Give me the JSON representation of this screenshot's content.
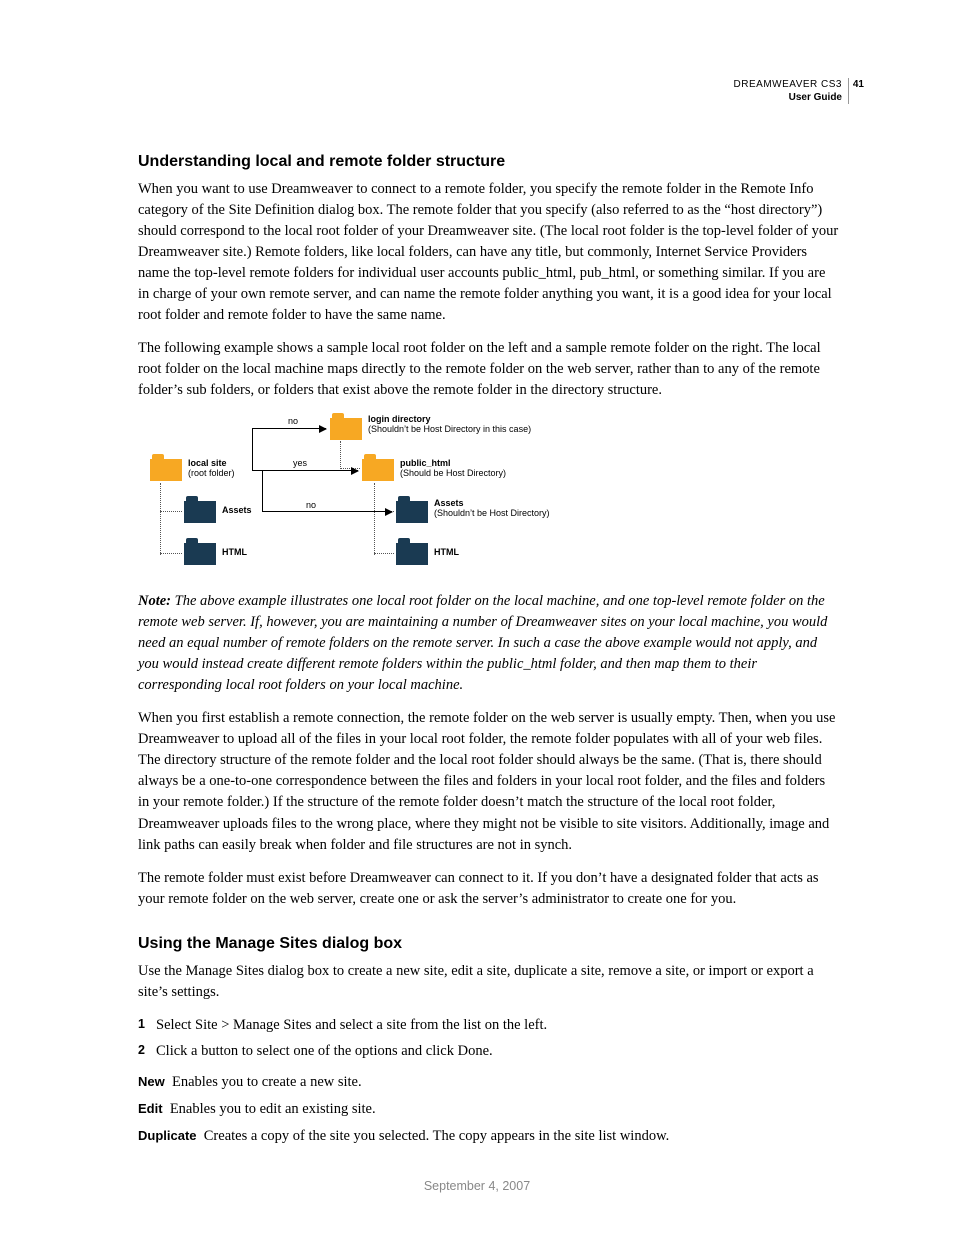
{
  "header": {
    "product": "DREAMWEAVER CS3",
    "guide": "User Guide",
    "page": "41"
  },
  "h1": "Understanding local and remote folder structure",
  "p1": "When you want to use Dreamweaver to connect to a remote folder, you specify the remote folder in the Remote Info category of the Site Definition dialog box. The remote folder that you specify (also referred to as the “host directory”) should correspond to the local root folder of your Dreamweaver site. (The local root folder is the top-level folder of your Dreamweaver site.) Remote folders, like local folders, can have any title, but commonly, Internet Service Providers name the top-level remote folders for individual user accounts public_html, pub_html, or something similar. If you are in charge of your own remote server, and can name the remote folder anything you want, it is a good idea for your local root folder and remote folder to have the same name.",
  "p2": "The following example shows a sample local root folder on the left and a sample remote folder on the right. The local root folder on the local machine maps directly to the remote folder on the web server, rather than to any of the remote folder’s sub folders, or folders that exist above the remote folder in the directory structure.",
  "diagram": {
    "local_root": {
      "t": "local site",
      "s": "(root folder)"
    },
    "local_assets": "Assets",
    "local_html": "HTML",
    "remote_login": {
      "t": "login directory",
      "s": "(Shouldn’t be Host Directory in this case)"
    },
    "remote_public": {
      "t": "public_html",
      "s": "(Should be Host Directory)"
    },
    "remote_assets": {
      "t": "Assets",
      "s": "(Shouldn’t be Host Directory)"
    },
    "remote_html": "HTML",
    "tag_no1": "no",
    "tag_yes": "yes",
    "tag_no2": "no"
  },
  "noteLabel": "Note:",
  "note": " The above example illustrates one local root folder on the local machine, and one top-level remote folder on the remote web server. If, however, you are maintaining a number of Dreamweaver sites on your local machine, you would need an equal number of remote folders on the remote server. In such a case the above example would not apply, and you would instead create different remote folders within the public_html folder, and then map them to their corresponding local root folders on your local machine.",
  "p3": "When you first establish a remote connection, the remote folder on the web server is usually empty. Then, when you use Dreamweaver to upload all of the files in your local root folder, the remote folder populates with all of your web files. The directory structure of the remote folder and the local root folder should always be the same. (That is, there should always be a one-to-one correspondence between the files and folders in your local root folder, and the files and folders in your remote folder.) If the structure of the remote folder doesn’t match the structure of the local root folder, Dreamweaver uploads files to the wrong place, where they might not be visible to site visitors. Additionally, image and link paths can easily break when folder and file structures are not in synch.",
  "p4": "The remote folder must exist before Dreamweaver can connect to it. If you don’t have a designated folder that acts as your remote folder on the web server, create one or ask the server’s administrator to create one for you.",
  "h2": "Using the Manage Sites dialog box",
  "p5": "Use the Manage Sites dialog box to create a new site, edit a site, duplicate a site, remove a site, or import or export a site’s settings.",
  "steps": [
    "Select Site > Manage Sites and select a site from the list on the left.",
    "Click a button to select one of the options and click Done."
  ],
  "defs": [
    {
      "term": "New",
      "desc": "Enables you to create a new site."
    },
    {
      "term": "Edit",
      "desc": "Enables you to edit an existing site."
    },
    {
      "term": "Duplicate",
      "desc": "Creates a copy of the site you selected. The copy appears in the site list window."
    }
  ],
  "footer": "September 4, 2007"
}
